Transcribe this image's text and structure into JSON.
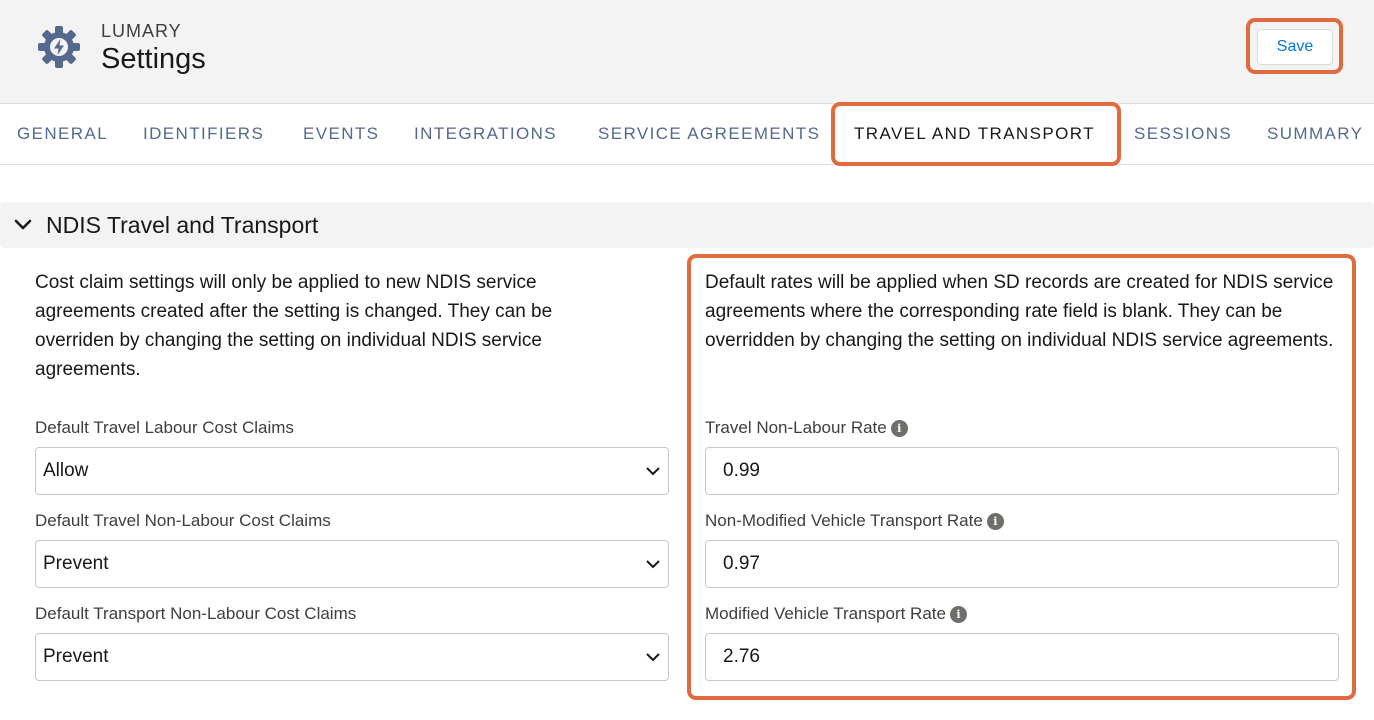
{
  "header": {
    "app_name": "LUMARY",
    "title": "Settings",
    "save_label": "Save"
  },
  "tabs": [
    {
      "label": "GENERAL"
    },
    {
      "label": "IDENTIFIERS"
    },
    {
      "label": "EVENTS"
    },
    {
      "label": "INTEGRATIONS"
    },
    {
      "label": "SERVICE AGREEMENTS"
    },
    {
      "label": "TRAVEL AND TRANSPORT",
      "active": true
    },
    {
      "label": "SESSIONS"
    },
    {
      "label": "SUMMARY"
    }
  ],
  "section": {
    "title": "NDIS Travel and Transport",
    "left": {
      "description": "Cost claim settings will only be applied to new NDIS service agreements created after the setting is changed. They can be overriden by changing the setting on individual NDIS service agreements.",
      "fields": [
        {
          "label": "Default Travel Labour Cost Claims",
          "value": "Allow"
        },
        {
          "label": "Default Travel Non-Labour Cost Claims",
          "value": "Prevent"
        },
        {
          "label": "Default Transport Non-Labour Cost Claims",
          "value": "Prevent"
        }
      ]
    },
    "right": {
      "description": "Default rates will be applied when SD records are created for NDIS service agreements where the corresponding rate field is blank. They can be overridden by changing the setting on individual NDIS service agreements.",
      "fields": [
        {
          "label": "Travel Non-Labour Rate",
          "value": "0.99"
        },
        {
          "label": "Non-Modified Vehicle Transport Rate",
          "value": "0.97"
        },
        {
          "label": "Modified Vehicle Transport Rate",
          "value": "2.76"
        }
      ]
    }
  },
  "colors": {
    "highlight": "#e06b3f",
    "brand_icon": "#54698d",
    "link": "#0176d3"
  },
  "icons": {
    "app": "gear-bolt-icon",
    "section_toggle": "chevron-down-icon",
    "select": "chevron-down-icon",
    "info": "info-icon"
  }
}
